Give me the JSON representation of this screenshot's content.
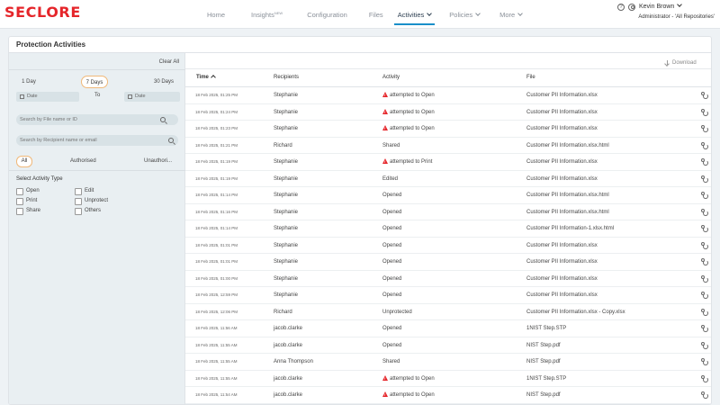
{
  "header": {
    "logo_text": "SECLORE",
    "nav": [
      {
        "label": "Home",
        "name": "nav-home"
      },
      {
        "label": "Insights",
        "sup": "NEW",
        "name": "nav-insights"
      },
      {
        "label": "Configuration",
        "name": "nav-configuration"
      },
      {
        "label": "Files",
        "name": "nav-files"
      },
      {
        "label": "Activities",
        "name": "nav-activities",
        "active": true,
        "dropdown": true
      },
      {
        "label": "Policies",
        "name": "nav-policies",
        "dropdown": true
      },
      {
        "label": "More",
        "name": "nav-more",
        "dropdown": true
      }
    ],
    "help_icon": "?",
    "user_name": "Kevin Brown",
    "user_role": "Administrator - 'All Repositories'"
  },
  "panel": {
    "title": "Protection Activities"
  },
  "filters": {
    "clear_all": "Clear All",
    "days": [
      "1 Day",
      "7 Days",
      "30 Days"
    ],
    "selected_days": "7 Days",
    "date_from_placeholder": "Date",
    "to_label": "To",
    "date_to_placeholder": "Date",
    "search_file_placeholder": "Search by File name or ID",
    "search_recipient_placeholder": "Search by Recipient name or email",
    "auth_tabs": [
      "All",
      "Authorised",
      "Unauthori..."
    ],
    "activity_type_title": "Select Activity Type",
    "activity_types_left": [
      "Open",
      "Print",
      "Share"
    ],
    "activity_types_right": [
      "Edit",
      "Unprotect",
      "Others"
    ]
  },
  "table": {
    "download_label": "Download",
    "columns": {
      "time": "Time",
      "recipients": "Recipients",
      "activity": "Activity",
      "file": "File"
    },
    "rows": [
      {
        "time": "18 Feb 2025, 01:25 PM",
        "recipient": "Stephanie",
        "activity": "attempted to Open",
        "warn": true,
        "file": "Customer PII Information.xlsx"
      },
      {
        "time": "18 Feb 2025, 01:24 PM",
        "recipient": "Stephanie",
        "activity": "attempted to Open",
        "warn": true,
        "file": "Customer PII Information.xlsx"
      },
      {
        "time": "18 Feb 2025, 01:23 PM",
        "recipient": "Stephanie",
        "activity": "attempted to Open",
        "warn": true,
        "file": "Customer PII Information.xlsx"
      },
      {
        "time": "18 Feb 2025, 01:21 PM",
        "recipient": "Richard",
        "activity": "Shared",
        "warn": false,
        "file": "Customer PII Information.xlsx.html"
      },
      {
        "time": "18 Feb 2025, 01:19 PM",
        "recipient": "Stephanie",
        "activity": "attempted to Print",
        "warn": true,
        "file": "Customer PII Information.xlsx"
      },
      {
        "time": "18 Feb 2025, 01:19 PM",
        "recipient": "Stephanie",
        "activity": "Edited",
        "warn": false,
        "file": "Customer PII Information.xlsx"
      },
      {
        "time": "18 Feb 2025, 01:14 PM",
        "recipient": "Stephanie",
        "activity": "Opened",
        "warn": false,
        "file": "Customer PII Information.xlsx.html"
      },
      {
        "time": "18 Feb 2025, 01:16 PM",
        "recipient": "Stephanie",
        "activity": "Opened",
        "warn": false,
        "file": "Customer PII Information.xlsx.html"
      },
      {
        "time": "18 Feb 2025, 01:14 PM",
        "recipient": "Stephanie",
        "activity": "Opened",
        "warn": false,
        "file": "Customer PII Information-1.xlsx.html"
      },
      {
        "time": "18 Feb 2025, 01:01 PM",
        "recipient": "Stephanie",
        "activity": "Opened",
        "warn": false,
        "file": "Customer PII Information.xlsx"
      },
      {
        "time": "18 Feb 2025, 01:01 PM",
        "recipient": "Stephanie",
        "activity": "Opened",
        "warn": false,
        "file": "Customer PII Information.xlsx"
      },
      {
        "time": "18 Feb 2025, 01:00 PM",
        "recipient": "Stephanie",
        "activity": "Opened",
        "warn": false,
        "file": "Customer PII Information.xlsx"
      },
      {
        "time": "18 Feb 2025, 12:59 PM",
        "recipient": "Stephanie",
        "activity": "Opened",
        "warn": false,
        "file": "Customer PII Information.xlsx"
      },
      {
        "time": "18 Feb 2025, 12:06 PM",
        "recipient": "Richard",
        "activity": "Unprotected",
        "warn": false,
        "file": "Customer PII Information.xlsx - Copy.xlsx"
      },
      {
        "time": "18 Feb 2025, 11:56 AM",
        "recipient": "jacob.clarke",
        "activity": "Opened",
        "warn": false,
        "file": "1NIST Step.STP"
      },
      {
        "time": "18 Feb 2025, 11:55 AM",
        "recipient": "jacob.clarke",
        "activity": "Opened",
        "warn": false,
        "file": "NIST Step.pdf"
      },
      {
        "time": "18 Feb 2025, 11:55 AM",
        "recipient": "Anna Thompson",
        "activity": "Shared",
        "warn": false,
        "file": "NIST Step.pdf"
      },
      {
        "time": "18 Feb 2025, 11:55 AM",
        "recipient": "jacob.clarke",
        "activity": "attempted to Open",
        "warn": true,
        "file": "1NIST Step.STP"
      },
      {
        "time": "18 Feb 2025, 11:54 AM",
        "recipient": "jacob.clarke",
        "activity": "attempted to Open",
        "warn": true,
        "file": "NIST Step.pdf"
      }
    ]
  }
}
